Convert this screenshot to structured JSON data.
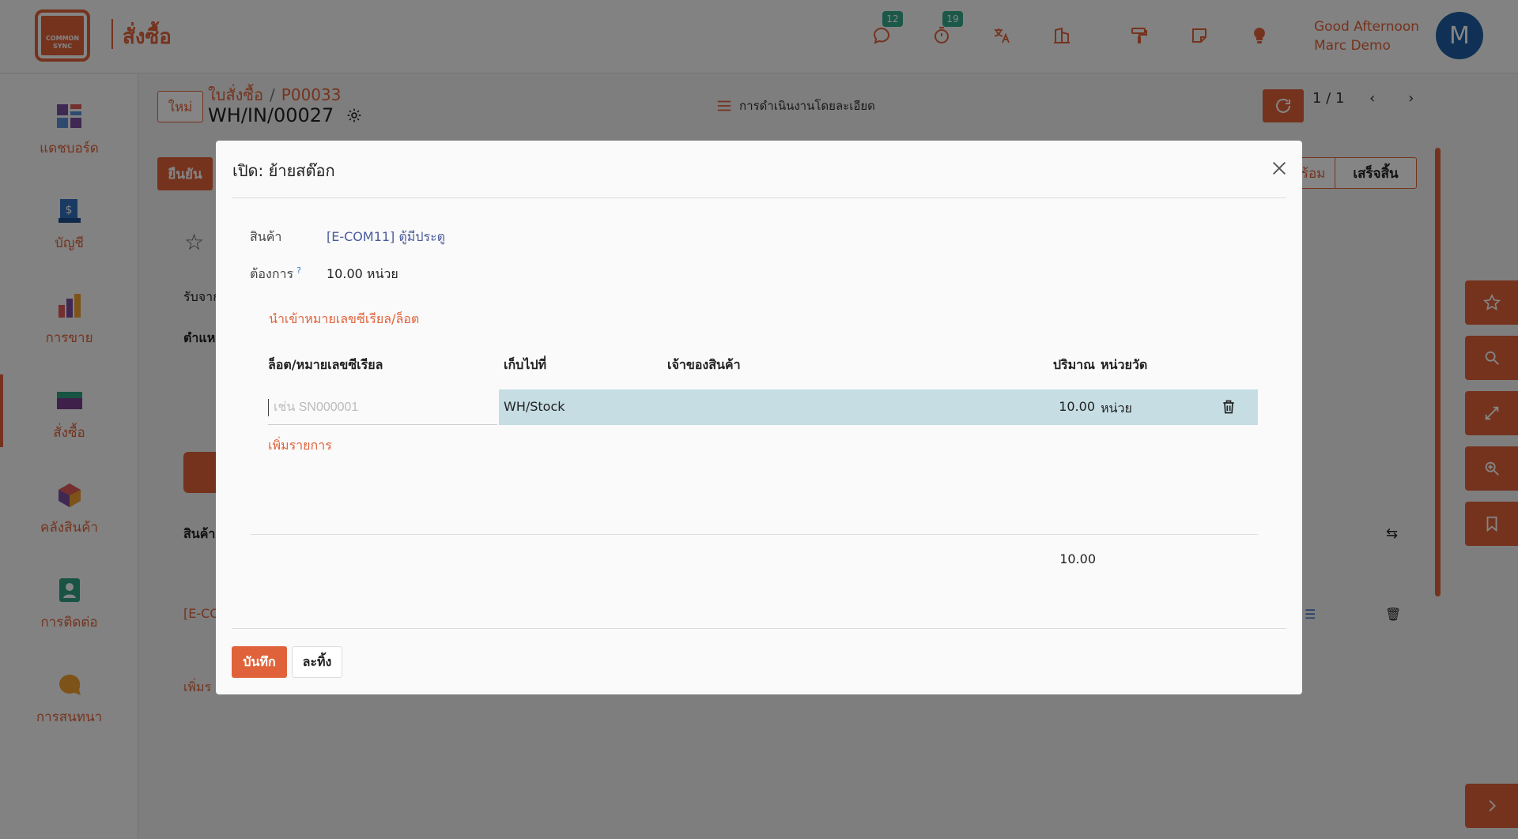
{
  "topbar": {
    "logo_line1": "COMMON",
    "logo_line2": "SYNC",
    "app_title": "สั่งซื้อ",
    "messages_badge": "12",
    "activities_badge": "19",
    "greeting_line1": "Good Afternoon",
    "greeting_line2": "Marc Demo",
    "avatar_letter": "M"
  },
  "sidebar": {
    "items": [
      {
        "label": "แดชบอร์ด",
        "icon": "dashboard-icon"
      },
      {
        "label": "บัญชี",
        "icon": "accounting-icon"
      },
      {
        "label": "การขาย",
        "icon": "sales-icon"
      },
      {
        "label": "สั่งซื้อ",
        "icon": "purchase-icon"
      },
      {
        "label": "คลังสินค้า",
        "icon": "inventory-icon"
      },
      {
        "label": "การติดต่อ",
        "icon": "contacts-icon"
      },
      {
        "label": "การสนทนา",
        "icon": "discuss-icon"
      }
    ]
  },
  "record": {
    "new_button": "ใหม่",
    "breadcrumb_parent": "ใบสั่งซื้อ",
    "breadcrumb_sep": "/",
    "breadcrumb_child": "P00033",
    "title": "WH/IN/00027",
    "actions_menu": "การดำเนินงานโดยละเอียด",
    "pager": "1 / 1",
    "confirm_button": "ยืนยัน",
    "status_ready": "พร้อม",
    "status_done": "เสร็จสิ้น",
    "receive_from": "รับจาก",
    "location": "ตำแห",
    "products_tab": "สินค้า",
    "product_line": "[E-CO",
    "add_line": "เพิ่มร"
  },
  "modal": {
    "title": "เปิด: ย้ายสต๊อก",
    "product_label": "สินค้า",
    "product_value": "[E-COM11] ตู้มีประตู",
    "demand_label": "ต้องการ",
    "demand_help": "?",
    "demand_value": "10.00 หน่วย",
    "import_link": "นำเข้าหมายเลขซีเรียล/ล็อต",
    "columns": {
      "lot": "ล็อต/หมายเลขซีเรียล",
      "location": "เก็บไปที่",
      "owner": "เจ้าของสินค้า",
      "quantity": "ปริมาณ",
      "uom": "หน่วยวัด"
    },
    "row": {
      "lot_placeholder": "เช่น SN000001",
      "location": "WH/Stock",
      "quantity": "10.00",
      "uom": "หน่วย"
    },
    "add_line": "เพิ่มรายการ",
    "total": "10.00",
    "save_button": "บันทึก",
    "discard_button": "ละทิ้ง"
  },
  "colors": {
    "accent": "#e0623a",
    "selected_row": "#c5dde3",
    "badge": "#36a98a",
    "avatar": "#1f5fa3"
  }
}
